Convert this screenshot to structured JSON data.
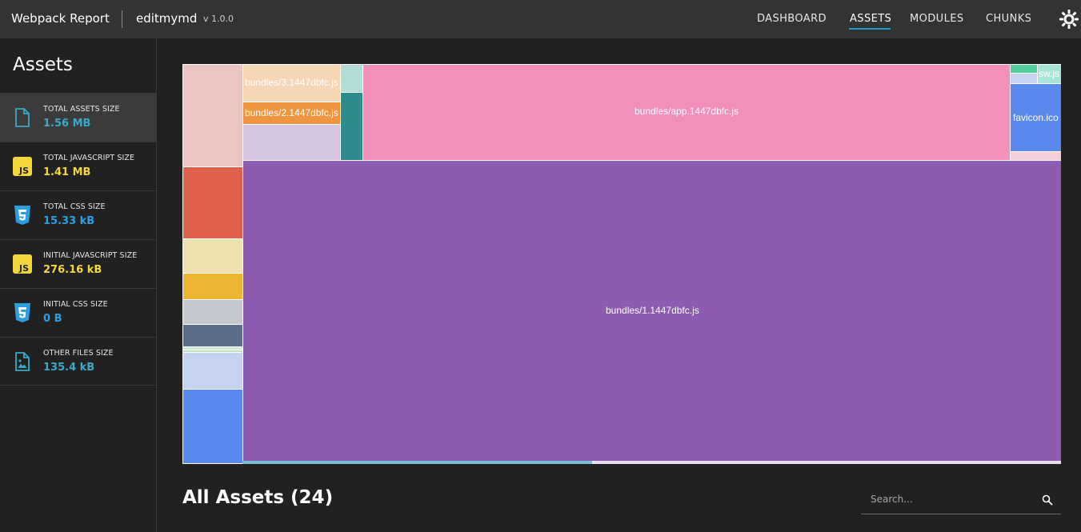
{
  "header": {
    "brand": "Webpack Report",
    "project": "editmymd",
    "version": "v 1.0.0",
    "nav": [
      {
        "label": "DASHBOARD"
      },
      {
        "label": "ASSETS"
      },
      {
        "label": "MODULES"
      },
      {
        "label": "CHUNKS"
      }
    ],
    "active_nav": "ASSETS",
    "theme_toggle_icon": "sun-icon",
    "accent_color": "#1ea0c6"
  },
  "sidebar": {
    "title": "Assets",
    "stats": [
      {
        "label": "TOTAL ASSETS SIZE",
        "value": "1.56 MB",
        "icon": "file-icon",
        "color": "#3aa8c8"
      },
      {
        "label": "TOTAL JAVASCRIPT SIZE",
        "value": "1.41 MB",
        "icon": "js-icon",
        "color": "#f2d63c"
      },
      {
        "label": "TOTAL CSS SIZE",
        "value": "15.33 kB",
        "icon": "css3-icon",
        "color": "#2d9fe0"
      },
      {
        "label": "INITIAL JAVASCRIPT SIZE",
        "value": "276.16 kB",
        "icon": "js-icon",
        "color": "#f2d63c"
      },
      {
        "label": "INITIAL CSS SIZE",
        "value": "0 B",
        "icon": "css3-icon",
        "color": "#2d9fe0"
      },
      {
        "label": "OTHER FILES SIZE",
        "value": "135.4 kB",
        "icon": "image-file-icon",
        "color": "#3aa8c8"
      }
    ]
  },
  "treemap": {
    "labels": {
      "bundle1": "bundles/1.1447dbfc.js",
      "app": "bundles/app.1447dbfc.js",
      "bundle3": "bundles/3.1447dbfc.js",
      "bundle2": "bundles/2.1447dbfc.js",
      "favicon": "favicon.ico",
      "sw": "sw.js"
    },
    "colors": {
      "bundle1": "#8e5bb0",
      "app": "#f28fbb",
      "bundle3": "#f5d5b3",
      "bundle2": "#ef9540",
      "favicon": "#5a8aee",
      "sw": "#a8e4d8"
    }
  },
  "assets_section": {
    "title": "All Assets (24)",
    "search_placeholder": "Search...",
    "search_icon": "search-icon"
  }
}
